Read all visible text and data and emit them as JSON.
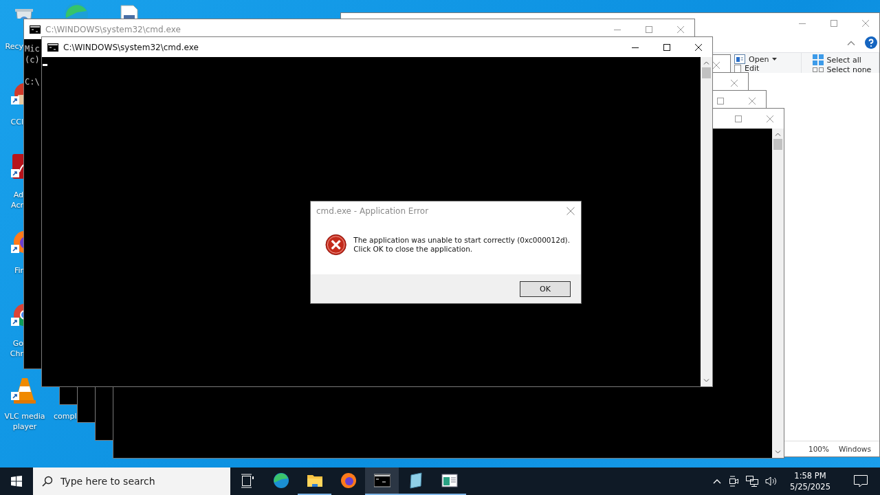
{
  "desktop": {
    "icons": [
      {
        "kind": "recycle",
        "lines": [
          "Recy"
        ]
      },
      {
        "kind": "edge"
      },
      {
        "kind": "file"
      },
      {
        "kind": "ccleaner",
        "lines": [
          "CCl"
        ]
      },
      {
        "kind": "acrobat",
        "lines": [
          "Ad",
          "Acr"
        ]
      },
      {
        "kind": "firefox",
        "lines": [
          "Fir"
        ]
      },
      {
        "kind": "chrome",
        "lines": [
          "Go",
          "Chr"
        ]
      },
      {
        "kind": "vlc",
        "lines": [
          "VLC media",
          "player"
        ]
      },
      {
        "kind": "none",
        "lines": [
          "compl"
        ]
      }
    ]
  },
  "explorer": {
    "controls": [
      {
        "kind": "min"
      },
      {
        "kind": "max"
      },
      {
        "kind": "close"
      }
    ],
    "ribbon": [
      [
        {
          "kind": "open",
          "label": "Open"
        },
        {
          "kind": "edit",
          "label": "Edit"
        }
      ],
      [
        {
          "kind": "selectall",
          "label": "Select all"
        },
        {
          "kind": "selectnone",
          "label": "Select none"
        }
      ]
    ],
    "status": [
      "100%",
      "Windows"
    ]
  },
  "windows": [
    {
      "title": "C:\\WINDOWS\\system32\\cmd.exe",
      "active": false,
      "controls": [
        {
          "kind": "min"
        },
        {
          "kind": "max"
        },
        {
          "kind": "close"
        }
      ],
      "lines": [
        "Mic",
        "(c)"
      ],
      "prompt": "C:\\"
    },
    {
      "controls": [
        {
          "kind": "close"
        }
      ]
    },
    {
      "controls": [
        {
          "kind": "close"
        }
      ]
    },
    {
      "controls": [
        {
          "kind": "max"
        },
        {
          "kind": "close"
        }
      ]
    },
    {
      "scrollbar": true,
      "controls": [
        {
          "kind": "max"
        },
        {
          "kind": "close"
        }
      ]
    },
    {
      "title": "C:\\WINDOWS\\system32\\cmd.exe",
      "active": true,
      "scrollbar": true,
      "cursor": true,
      "controls": [
        {
          "kind": "min"
        },
        {
          "kind": "max"
        },
        {
          "kind": "close"
        }
      ]
    }
  ],
  "dialog": {
    "title": "cmd.exe - Application Error",
    "active": false,
    "message": [
      "The application was unable to start correctly (0xc000012d).",
      "Click OK to close the application."
    ],
    "button": "OK"
  },
  "taskbar": {
    "search": {
      "placeholder": "Type here to search"
    },
    "apps": [
      {
        "kind": "taskview",
        "running": false,
        "selected": false
      },
      {
        "kind": "edge",
        "running": false,
        "selected": false
      },
      {
        "kind": "folder",
        "running": true,
        "selected": false
      },
      {
        "kind": "firefox",
        "running": false,
        "selected": false
      },
      {
        "kind": "cmd",
        "running": true,
        "selected": true
      },
      {
        "kind": "notepad",
        "running": true,
        "selected": false
      },
      {
        "kind": "window",
        "running": true,
        "selected": false
      }
    ],
    "time": "1:58 PM",
    "date": "5/25/2025"
  }
}
